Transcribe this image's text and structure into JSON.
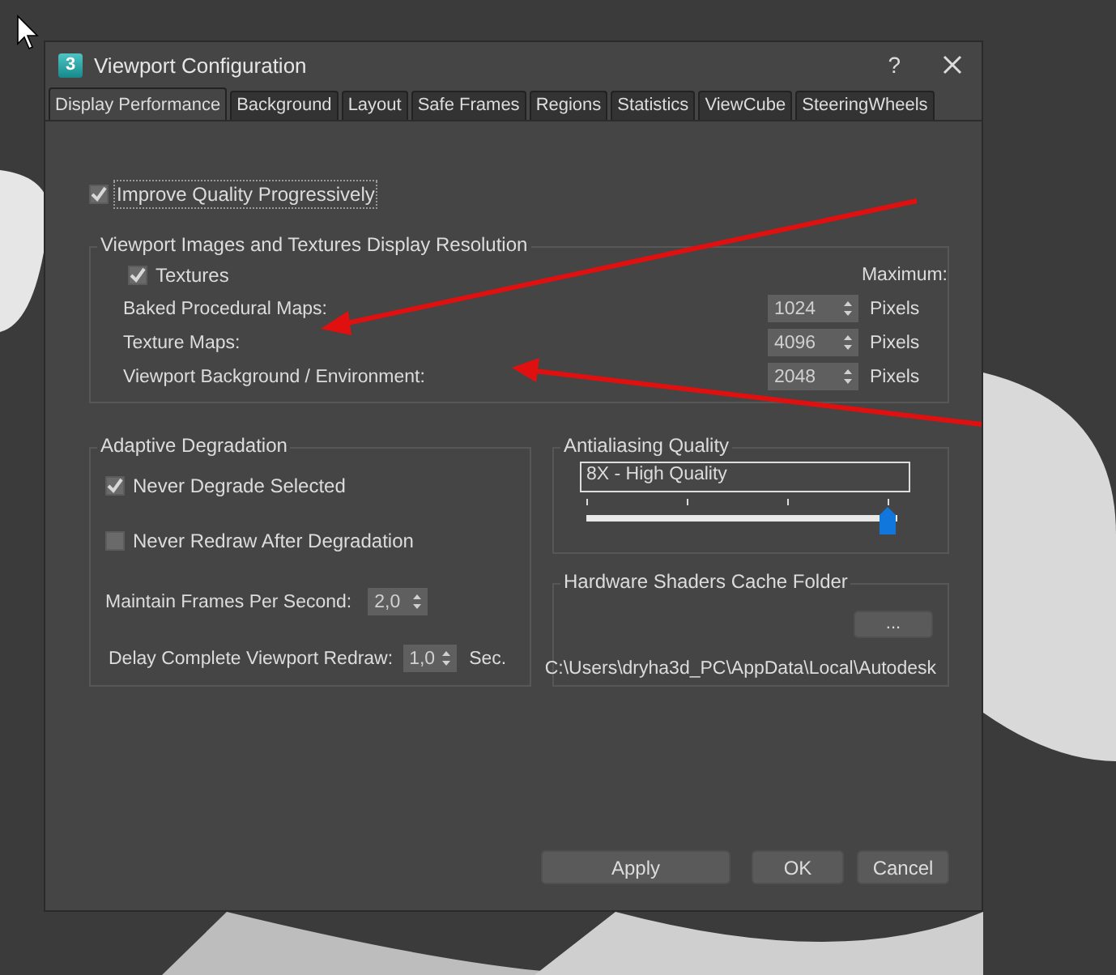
{
  "window": {
    "title": "Viewport Configuration",
    "icon_glyph": "3",
    "help": "?"
  },
  "tabs": [
    {
      "label": "Display Performance",
      "selected": true
    },
    {
      "label": "Background",
      "selected": false
    },
    {
      "label": "Layout",
      "selected": false
    },
    {
      "label": "Safe Frames",
      "selected": false
    },
    {
      "label": "Regions",
      "selected": false
    },
    {
      "label": "Statistics",
      "selected": false
    },
    {
      "label": "ViewCube",
      "selected": false
    },
    {
      "label": "SteeringWheels",
      "selected": false
    }
  ],
  "improve_quality": {
    "label": "Improve Quality Progressively",
    "checked": true
  },
  "resolution_group": {
    "title": "Viewport Images and Textures Display Resolution",
    "textures": {
      "label": "Textures",
      "checked": true
    },
    "maximum_label": "Maximum:",
    "rows": [
      {
        "label": "Baked Procedural Maps:",
        "value": "1024",
        "unit": "Pixels"
      },
      {
        "label": "Texture Maps:",
        "value": "4096",
        "unit": "Pixels"
      },
      {
        "label": "Viewport Background / Environment:",
        "value": "2048",
        "unit": "Pixels"
      }
    ]
  },
  "adaptive_degradation": {
    "title": "Adaptive Degradation",
    "options": [
      {
        "label": "Never Degrade Selected",
        "checked": true
      },
      {
        "label": "Never Redraw After Degradation",
        "checked": false
      }
    ],
    "fps": {
      "label": "Maintain Frames Per Second:",
      "value": "2,0"
    },
    "delay": {
      "label": "Delay Complete Viewport Redraw:",
      "value": "1,0",
      "unit": "Sec."
    }
  },
  "antialiasing": {
    "title": "Antialiasing Quality",
    "value": "8X - High Quality",
    "level": 1
  },
  "shaders_cache": {
    "title": "Hardware Shaders Cache Folder",
    "browse": "...",
    "path": "C:\\Users\\dryha3d_PC\\AppData\\Local\\Autodesk"
  },
  "buttons": [
    {
      "label": "Apply",
      "kind": "wide"
    },
    {
      "label": "OK",
      "kind": "normal"
    },
    {
      "label": "Cancel",
      "kind": "normal"
    }
  ]
}
